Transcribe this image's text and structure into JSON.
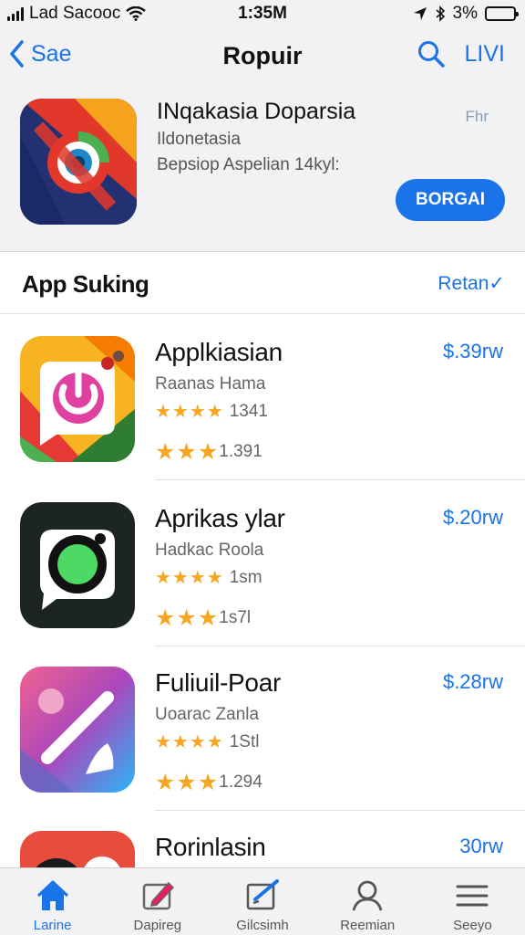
{
  "status_bar": {
    "carrier": "Lad Sacooc",
    "time": "1:35M",
    "battery": "3%"
  },
  "nav": {
    "back_label": "Sae",
    "title": "Ropuir",
    "right_label": "LIVI"
  },
  "featured": {
    "title": "INqakasia Doparsia",
    "subtitle1": "Ildonetasia",
    "subtitle2": "Bepsiop Aspelian 14kyl:",
    "price": "Fhr",
    "button_label": "BORGAI"
  },
  "section": {
    "title": "App Suking",
    "link": "Retan✓"
  },
  "apps": [
    {
      "name": "Applkiasian",
      "developer": "Raanas Hama",
      "rating_count": "1341",
      "rating_count2": "1.391",
      "price": "$.39rw"
    },
    {
      "name": "Aprikas ylar",
      "developer": "Hadkac Roola",
      "rating_count": "1sm",
      "rating_count2": "1s7l",
      "price": "$.20rw"
    },
    {
      "name": "Fuliuil-Poar",
      "developer": "Uoarac Zanla",
      "rating_count": "1Stl",
      "rating_count2": "1.294",
      "price": "$.28rw"
    },
    {
      "name": "Rorinlasin",
      "developer": "",
      "rating_count": "",
      "rating_count2": "",
      "price": "30rw"
    }
  ],
  "tabs": [
    {
      "label": "Larine",
      "icon": "home-icon"
    },
    {
      "label": "Dapireg",
      "icon": "pencil-box-icon"
    },
    {
      "label": "Gilcsimh",
      "icon": "checkbox-edit-icon"
    },
    {
      "label": "Reemian",
      "icon": "person-icon"
    },
    {
      "label": "Seeyo",
      "icon": "menu-icon"
    }
  ],
  "colors": {
    "accent": "#1a73e8",
    "star": "#f5a623",
    "bar_background": "#f2f2f4"
  }
}
